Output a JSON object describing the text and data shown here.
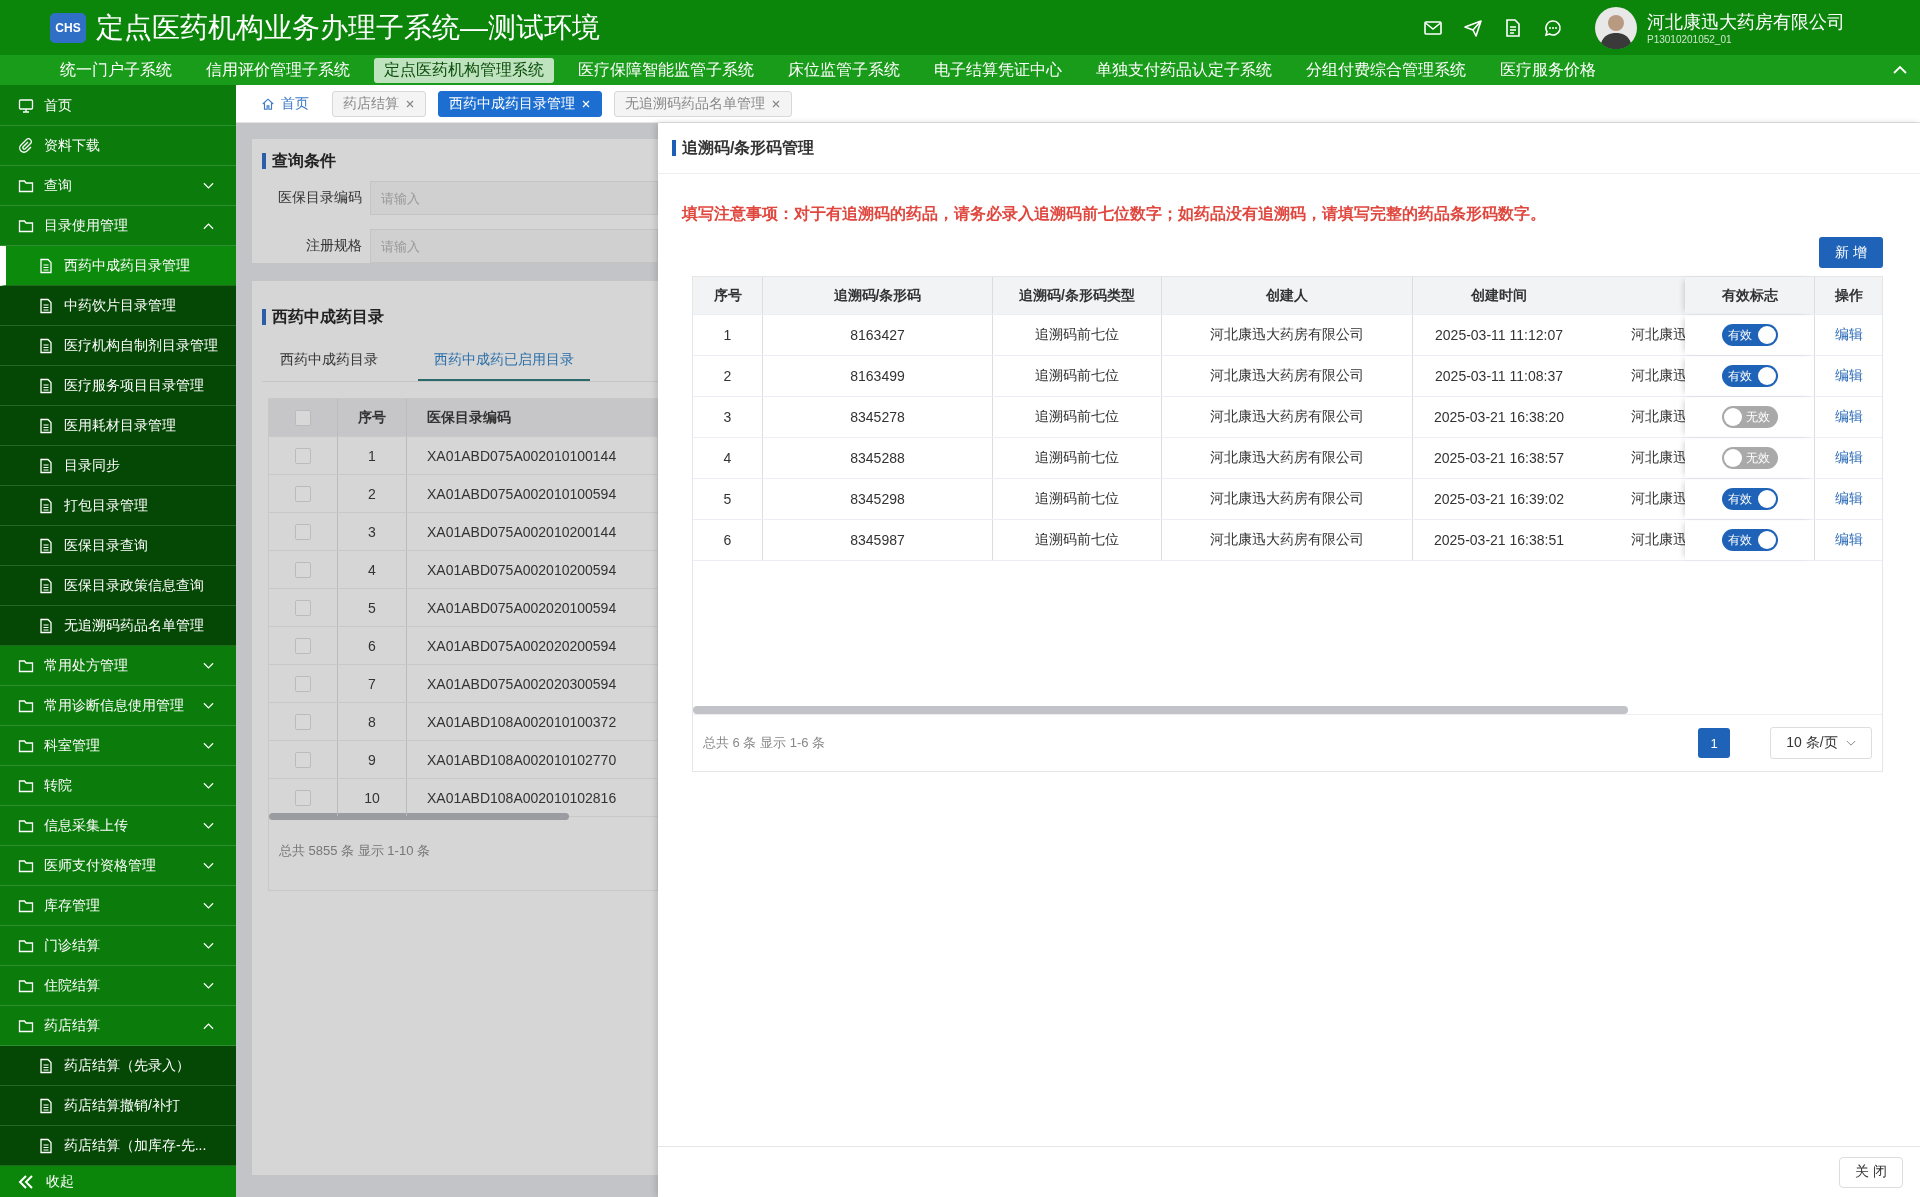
{
  "header": {
    "logo": "CHS",
    "title": "定点医药机构业务办理子系统—测试环境",
    "user": {
      "name": "河北康迅大药房有限公司",
      "code": "P13010201052_01"
    }
  },
  "nav": [
    {
      "label": "统一门户子系统",
      "selected": false
    },
    {
      "label": "信用评价管理子系统",
      "selected": false
    },
    {
      "label": "定点医药机构管理系统",
      "selected": true
    },
    {
      "label": "医疗保障智能监管子系统",
      "selected": false
    },
    {
      "label": "床位监管子系统",
      "selected": false
    },
    {
      "label": "电子结算凭证中心",
      "selected": false
    },
    {
      "label": "单独支付药品认定子系统",
      "selected": false
    },
    {
      "label": "分组付费综合管理系统",
      "selected": false
    },
    {
      "label": "医疗服务价格",
      "selected": false
    }
  ],
  "sidebar": {
    "items": [
      {
        "label": "首页",
        "kind": "home",
        "selected": false
      },
      {
        "label": "资料下载",
        "kind": "download",
        "selected": false
      },
      {
        "label": "查询",
        "kind": "group",
        "expanded": false,
        "selected": false
      },
      {
        "label": "目录使用管理",
        "kind": "group",
        "expanded": true,
        "selected": false,
        "children": [
          {
            "label": "西药中成药目录管理",
            "kind": "link",
            "selected": true
          },
          {
            "label": "中药饮片目录管理",
            "kind": "link",
            "selected": false
          },
          {
            "label": "医疗机构自制剂目录管理",
            "kind": "link",
            "selected": false
          },
          {
            "label": "医疗服务项目目录管理",
            "kind": "link",
            "selected": false
          },
          {
            "label": "医用耗材目录管理",
            "kind": "link",
            "selected": false
          },
          {
            "label": "目录同步",
            "kind": "link",
            "selected": false
          },
          {
            "label": "打包目录管理",
            "kind": "link",
            "selected": false
          },
          {
            "label": "医保目录查询",
            "kind": "link",
            "selected": false
          },
          {
            "label": "医保目录政策信息查询",
            "kind": "link",
            "selected": false
          },
          {
            "label": "无追溯码药品名单管理",
            "kind": "link",
            "selected": false
          }
        ]
      },
      {
        "label": "常用处方管理",
        "kind": "group",
        "expanded": false,
        "selected": false
      },
      {
        "label": "常用诊断信息使用管理",
        "kind": "group",
        "expanded": false,
        "selected": false
      },
      {
        "label": "科室管理",
        "kind": "group",
        "expanded": false,
        "selected": false
      },
      {
        "label": "转院",
        "kind": "group",
        "expanded": false,
        "selected": false
      },
      {
        "label": "信息采集上传",
        "kind": "group",
        "expanded": false,
        "selected": false
      },
      {
        "label": "医师支付资格管理",
        "kind": "group",
        "expanded": false,
        "selected": false
      },
      {
        "label": "库存管理",
        "kind": "group",
        "expanded": false,
        "selected": false
      },
      {
        "label": "门诊结算",
        "kind": "group",
        "expanded": false,
        "selected": false
      },
      {
        "label": "住院结算",
        "kind": "group",
        "expanded": false,
        "selected": false
      },
      {
        "label": "药店结算",
        "kind": "group",
        "expanded": true,
        "selected": false,
        "children": [
          {
            "label": "药店结算（先录入）",
            "kind": "link",
            "selected": false
          },
          {
            "label": "药店结算撤销/补打",
            "kind": "link",
            "selected": false
          },
          {
            "label": "药店结算（加库存-先...",
            "kind": "link",
            "selected": false
          }
        ]
      }
    ],
    "collapse": "收起"
  },
  "page_tabs": [
    {
      "label": "首页",
      "kind": "home",
      "selected": false
    },
    {
      "label": "药店结算",
      "kind": "closable",
      "selected": false
    },
    {
      "label": "西药中成药目录管理",
      "kind": "closable",
      "selected": true
    },
    {
      "label": "无追溯码药品名单管理",
      "kind": "closable",
      "selected": false
    }
  ],
  "query": {
    "title": "查询条件",
    "fields": [
      {
        "label": "医保目录编码",
        "placeholder": "请输入"
      },
      {
        "label": "注册规格",
        "placeholder": "请输入"
      }
    ]
  },
  "catalog": {
    "title": "西药中成药目录",
    "tabs": [
      {
        "label": "西药中成药目录",
        "selected": false
      },
      {
        "label": "西药中成药已启用目录",
        "selected": true
      }
    ],
    "all_checked": false,
    "columns": [
      "序号",
      "医保目录编码"
    ],
    "rows": [
      {
        "checked": false,
        "no": "1",
        "code": "XA01ABD075A002010100144"
      },
      {
        "checked": false,
        "no": "2",
        "code": "XA01ABD075A002010100594"
      },
      {
        "checked": false,
        "no": "3",
        "code": "XA01ABD075A002010200144"
      },
      {
        "checked": false,
        "no": "4",
        "code": "XA01ABD075A002010200594"
      },
      {
        "checked": false,
        "no": "5",
        "code": "XA01ABD075A002020100594"
      },
      {
        "checked": false,
        "no": "6",
        "code": "XA01ABD075A002020200594"
      },
      {
        "checked": false,
        "no": "7",
        "code": "XA01ABD075A002020300594"
      },
      {
        "checked": false,
        "no": "8",
        "code": "XA01ABD108A002010100372"
      },
      {
        "checked": false,
        "no": "9",
        "code": "XA01ABD108A002010102770"
      },
      {
        "checked": false,
        "no": "10",
        "code": "XA01ABD108A002010102816"
      }
    ],
    "summary": "总共 5855 条 显示 1-10 条"
  },
  "drawer": {
    "title": "追溯码/条形码管理",
    "notice": "填写注意事项：对于有追溯码的药品，请务必录入追溯码前七位数字；如药品没有追溯码，请填写完整的药品条形码数字。",
    "add_button": "新 增",
    "columns": [
      "序号",
      "追溯码/条形码",
      "追溯码/条形码类型",
      "创建人",
      "创建时间",
      "有效标志",
      "操作"
    ],
    "rows": [
      {
        "no": "1",
        "code": "8163427",
        "type": "追溯码前七位",
        "creator": "河北康迅大药房有限公司",
        "created": "2025-03-11 11:12:07",
        "column_6": "河北康迅",
        "status": {
          "label": "有效",
          "on": true
        },
        "action": "编辑"
      },
      {
        "no": "2",
        "code": "8163499",
        "type": "追溯码前七位",
        "creator": "河北康迅大药房有限公司",
        "created": "2025-03-11 11:08:37",
        "column_6": "河北康迅",
        "status": {
          "label": "有效",
          "on": true
        },
        "action": "编辑"
      },
      {
        "no": "3",
        "code": "8345278",
        "type": "追溯码前七位",
        "creator": "河北康迅大药房有限公司",
        "created": "2025-03-21 16:38:20",
        "column_6": "河北康迅",
        "status": {
          "label": "无效",
          "on": false
        },
        "action": "编辑"
      },
      {
        "no": "4",
        "code": "8345288",
        "type": "追溯码前七位",
        "creator": "河北康迅大药房有限公司",
        "created": "2025-03-21 16:38:57",
        "column_6": "河北康迅",
        "status": {
          "label": "无效",
          "on": false
        },
        "action": "编辑"
      },
      {
        "no": "5",
        "code": "8345298",
        "type": "追溯码前七位",
        "creator": "河北康迅大药房有限公司",
        "created": "2025-03-21 16:39:02",
        "column_6": "河北康迅",
        "status": {
          "label": "有效",
          "on": true
        },
        "action": "编辑"
      },
      {
        "no": "6",
        "code": "8345987",
        "type": "追溯码前七位",
        "creator": "河北康迅大药房有限公司",
        "created": "2025-03-21 16:38:51",
        "column_6": "河北康迅",
        "status": {
          "label": "有效",
          "on": true
        },
        "action": "编辑"
      }
    ],
    "summary": "总共 6 条 显示 1-6 条",
    "pages": [
      {
        "label": "1",
        "selected": true
      }
    ],
    "page_size": "10 条/页",
    "close_button": "关 闭"
  }
}
